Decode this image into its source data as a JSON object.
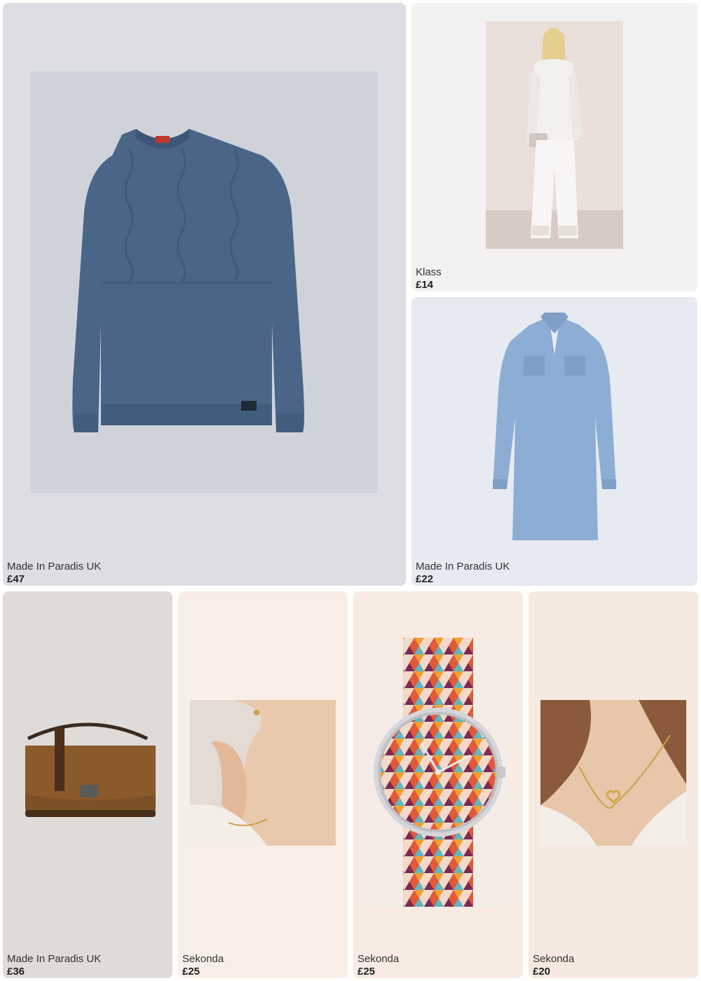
{
  "products": [
    {
      "brand": "Made In Paradis UK",
      "price": "£47",
      "image": "blue-cable-knit-sweater",
      "bg": "#dcdee3"
    },
    {
      "brand": "Klass",
      "price": "£14",
      "image": "white-lace-jacket-trouser-outfit",
      "bg": "#f4f2f1"
    },
    {
      "brand": "Made In Paradis UK",
      "price": "£22",
      "image": "denim-shirt-dress",
      "bg": "#e7eaf0"
    },
    {
      "brand": "Made In Paradis UK",
      "price": "£36",
      "image": "brown-suede-crossbody-bag",
      "bg": "#dedbd9"
    },
    {
      "brand": "Sekonda",
      "price": "£25",
      "image": "gold-infinity-bracelet-earrings",
      "bg": "#f9efe8"
    },
    {
      "brand": "Sekonda",
      "price": "£25",
      "image": "patterned-triangle-watch",
      "bg": "#f7ebe4"
    },
    {
      "brand": "Sekonda",
      "price": "£20",
      "image": "gold-heart-pendant-necklace",
      "bg": "#f6e9e2"
    }
  ],
  "colors": {
    "text": "#222222",
    "sweater": "#4a6588",
    "denim": "#8daed4",
    "bag": "#8a5a2b"
  }
}
